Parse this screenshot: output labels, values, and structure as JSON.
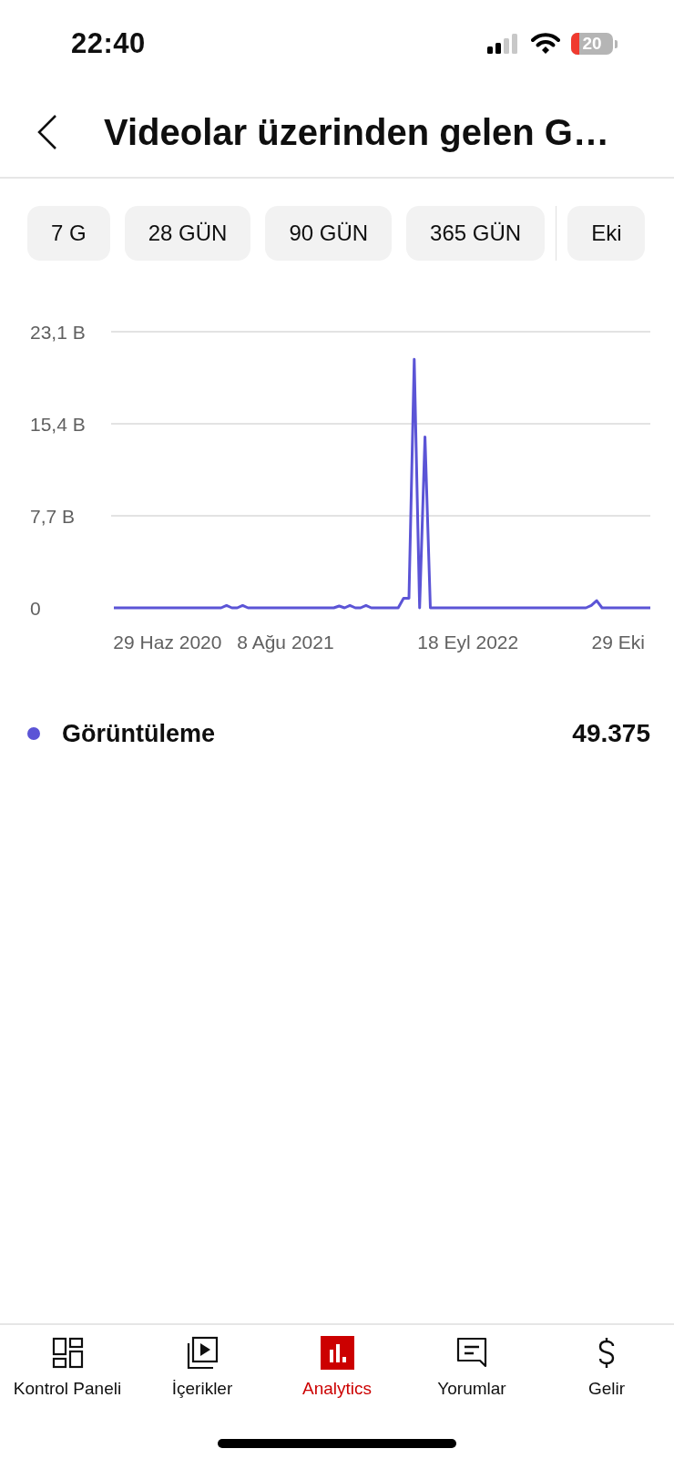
{
  "status_bar": {
    "time": "22:40",
    "battery": "20"
  },
  "header": {
    "title": "Videolar üzerinden gelen G…"
  },
  "periods": [
    {
      "label": "7 G",
      "selected": false
    },
    {
      "label": "28 GÜN",
      "selected": false
    },
    {
      "label": "90 GÜN",
      "selected": false
    },
    {
      "label": "365 GÜN",
      "selected": false
    },
    {
      "label": "Eki",
      "selected": false
    }
  ],
  "chart": {
    "chart_data": {
      "type": "line",
      "categories": [
        null,
        null,
        null,
        null,
        null,
        null,
        null,
        null,
        null,
        null,
        "29 Haz 2020",
        null,
        null,
        null,
        null,
        null,
        null,
        null,
        null,
        null,
        null,
        null,
        null,
        null,
        null,
        null,
        null,
        null,
        null,
        null,
        null,
        null,
        "8 Ağu 2021",
        null,
        null,
        null,
        null,
        null,
        null,
        null,
        null,
        null,
        null,
        null,
        null,
        null,
        null,
        null,
        null,
        null,
        null,
        null,
        null,
        null,
        null,
        null,
        null,
        null,
        null,
        null,
        null,
        null,
        null,
        null,
        null,
        null,
        "18 Eyl 2022",
        null,
        null,
        null,
        null,
        null,
        null,
        null,
        null,
        null,
        null,
        null,
        null,
        null,
        null,
        null,
        null,
        null,
        null,
        null,
        null,
        null,
        null,
        null,
        null,
        null,
        null,
        null,
        "29 Eki",
        null,
        null,
        null,
        null,
        null,
        null
      ],
      "series": [
        {
          "name": "Görüntüleme",
          "color": "#5b54d6",
          "values": [
            0,
            0,
            0,
            0,
            0,
            0,
            0,
            0,
            0,
            0,
            0,
            0,
            0,
            0,
            0,
            0,
            0,
            0,
            0,
            0,
            0,
            0.2,
            0,
            0,
            0.2,
            0,
            0,
            0,
            0,
            0,
            0,
            0,
            0,
            0,
            0,
            0,
            0,
            0,
            0,
            0,
            0,
            0,
            0.15,
            0,
            0.2,
            0,
            0,
            0.2,
            0,
            0,
            0,
            0,
            0,
            0,
            0.8,
            0.8,
            20.8,
            0,
            14.3,
            0,
            0,
            0,
            0,
            0,
            0,
            0,
            0,
            0,
            0,
            0,
            0,
            0,
            0,
            0,
            0,
            0,
            0,
            0,
            0,
            0,
            0,
            0,
            0,
            0,
            0,
            0,
            0,
            0,
            0,
            0.2,
            0.6,
            0,
            0,
            0,
            0,
            0,
            0,
            0,
            0,
            0,
            0
          ]
        }
      ],
      "ylim": [
        0,
        23.1
      ],
      "yticks": [
        {
          "value": 0,
          "label": "0"
        },
        {
          "value": 7.7,
          "label": "7,7 B"
        },
        {
          "value": 15.4,
          "label": "15,4 B"
        },
        {
          "value": 23.1,
          "label": "23,1 B"
        }
      ]
    }
  },
  "legend": [
    {
      "value": "49.375"
    }
  ],
  "nav": [
    {
      "kind": "dashboard",
      "label": "Kontrol Paneli",
      "selected": false
    },
    {
      "kind": "content",
      "label": "İçerikler",
      "selected": false
    },
    {
      "kind": "analytics",
      "label": "Analytics",
      "selected": true
    },
    {
      "kind": "comments",
      "label": "Yorumlar",
      "selected": false
    },
    {
      "kind": "earn",
      "label": "Gelir",
      "selected": false
    }
  ]
}
